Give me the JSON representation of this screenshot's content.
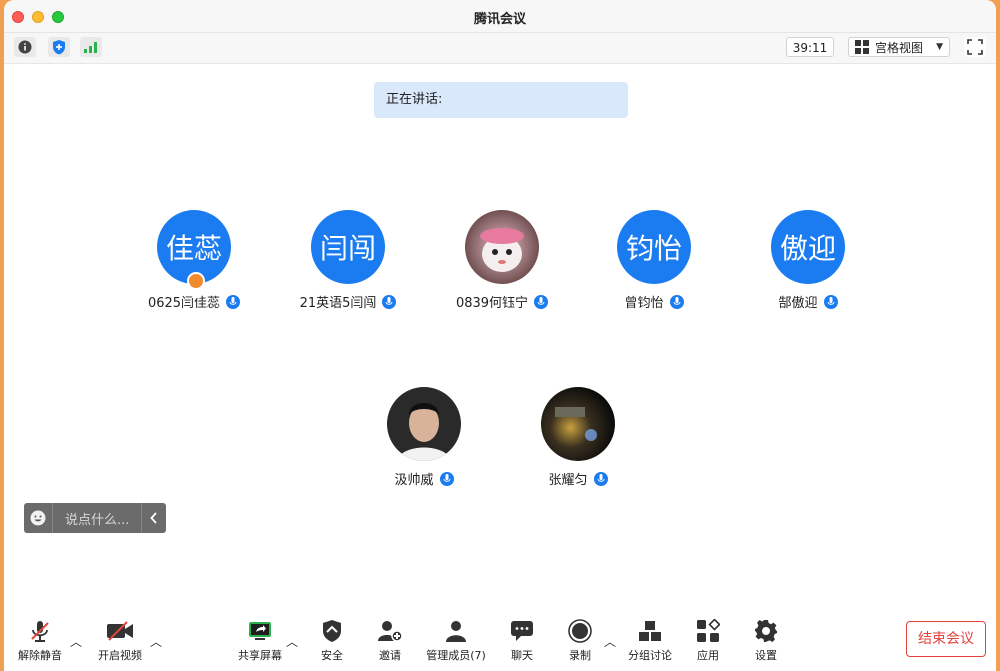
{
  "window": {
    "title": "腾讯会议"
  },
  "toolbar": {
    "timer": "39:11",
    "view_label": "宫格视图"
  },
  "speaking": {
    "label": "正在讲话:"
  },
  "participants": [
    {
      "avatar_text": "佳蕊",
      "name": "0625闫佳蕊",
      "type": "text"
    },
    {
      "avatar_text": "闫闯",
      "name": "21英语5闫闯",
      "type": "text"
    },
    {
      "avatar_text": "",
      "name": "0839何钰宁",
      "type": "photo"
    },
    {
      "avatar_text": "钧怡",
      "name": "曾钧怡",
      "type": "text"
    },
    {
      "avatar_text": "傲迎",
      "name": "郜傲迎",
      "type": "text"
    },
    {
      "avatar_text": "",
      "name": "汲帅威",
      "type": "photo"
    },
    {
      "avatar_text": "",
      "name": "张耀匀",
      "type": "photo"
    }
  ],
  "chat": {
    "placeholder": "说点什么..."
  },
  "bottom": {
    "unmute": "解除静音",
    "start_video": "开启视频",
    "share": "共享屏幕",
    "security": "安全",
    "invite": "邀请",
    "manage": "管理成员(7)",
    "chat": "聊天",
    "record": "录制",
    "breakout": "分组讨论",
    "apps": "应用",
    "settings": "设置",
    "end": "结束会议"
  },
  "colors": {
    "accent": "#1a7cf0",
    "end": "#e2433c"
  }
}
